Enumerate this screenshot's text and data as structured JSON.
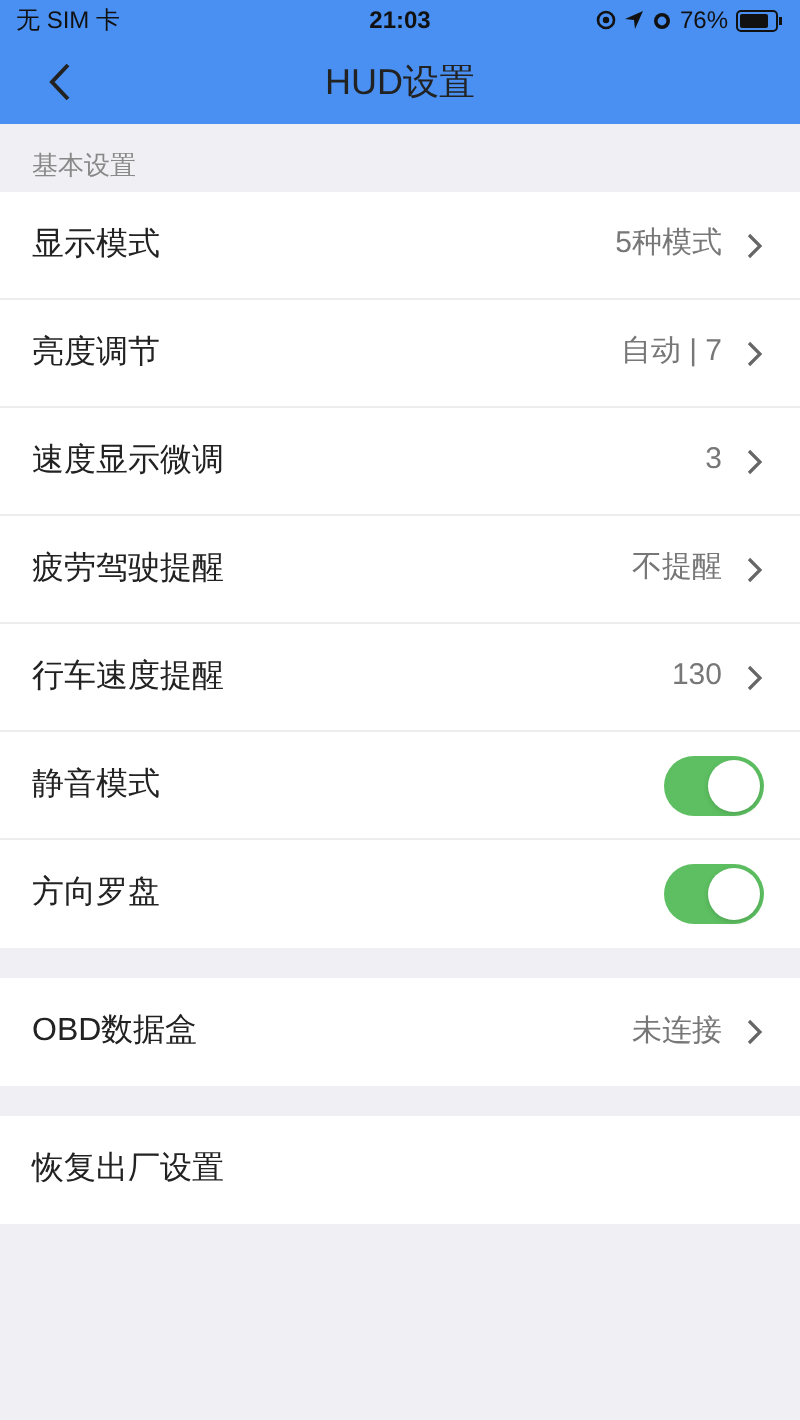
{
  "status_bar": {
    "carrier": "无 SIM 卡",
    "time": "21:03",
    "battery": "76%"
  },
  "nav": {
    "title": "HUD设置"
  },
  "sections": [
    {
      "header": "基本设置",
      "rows": [
        {
          "kind": "link",
          "label": "显示模式",
          "value": "5种模式"
        },
        {
          "kind": "link",
          "label": "亮度调节",
          "value": "自动 | 7"
        },
        {
          "kind": "link",
          "label": "速度显示微调",
          "value": "3"
        },
        {
          "kind": "link",
          "label": "疲劳驾驶提醒",
          "value": "不提醒"
        },
        {
          "kind": "link",
          "label": "行车速度提醒",
          "value": "130"
        },
        {
          "kind": "toggle",
          "label": "静音模式",
          "on": true
        },
        {
          "kind": "toggle",
          "label": "方向罗盘",
          "on": true
        }
      ]
    },
    {
      "rows": [
        {
          "kind": "link",
          "label": "OBD数据盒",
          "value": "未连接"
        }
      ]
    },
    {
      "rows": [
        {
          "kind": "plain",
          "label": "恢复出厂设置"
        }
      ]
    }
  ]
}
